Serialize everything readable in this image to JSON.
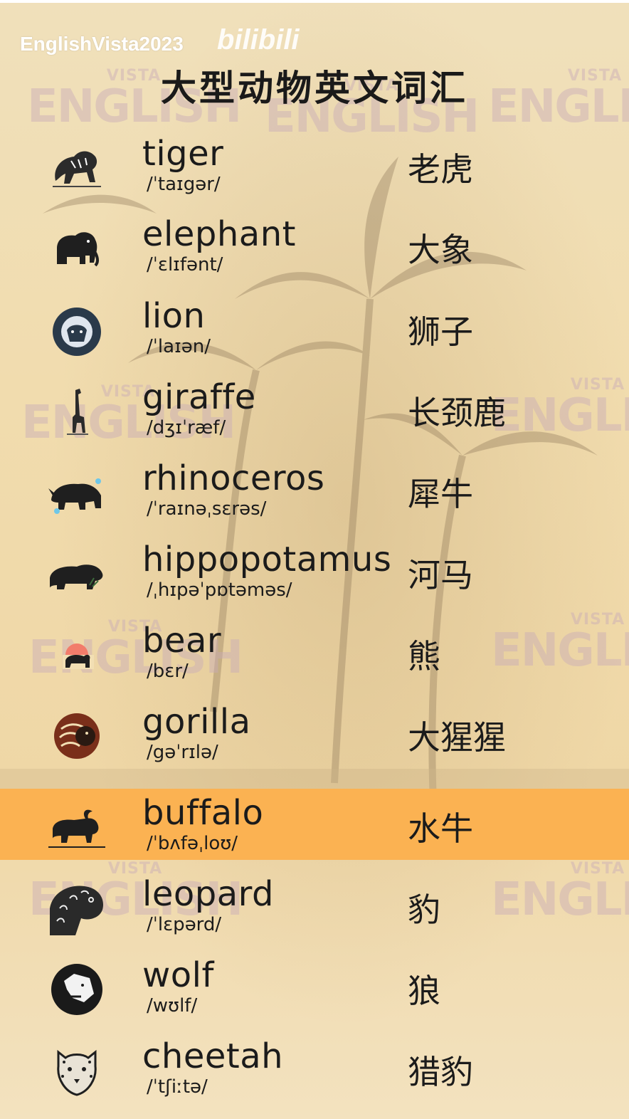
{
  "header": {
    "channel": "EnglishVista2023",
    "site_logo": "bilibili",
    "title": "大型动物英文词汇"
  },
  "watermark_text": "ENGLISH",
  "watermark_sub": "VISTA",
  "colors": {
    "background": "#f2dfb4",
    "highlight_row": "#fbb252",
    "text": "#1b1b1b"
  },
  "highlighted_index": 8,
  "words": [
    {
      "en": "tiger",
      "ipa": "/ˈtaɪgər/",
      "cn": "老虎",
      "icon": "tiger-icon"
    },
    {
      "en": "elephant",
      "ipa": "/ˈɛlɪfənt/",
      "cn": "大象",
      "icon": "elephant-icon"
    },
    {
      "en": "lion",
      "ipa": "/ˈlaɪən/",
      "cn": "狮子",
      "icon": "lion-icon"
    },
    {
      "en": "giraffe",
      "ipa": "/dʒɪˈræf/",
      "cn": "长颈鹿",
      "icon": "giraffe-icon"
    },
    {
      "en": "rhinoceros",
      "ipa": "/ˈraɪnəˌsɛrəs/",
      "cn": "犀牛",
      "icon": "rhinoceros-icon"
    },
    {
      "en": "hippopotamus",
      "ipa": "/ˌhɪpəˈpɒtəməs/",
      "cn": "河马",
      "icon": "hippopotamus-icon"
    },
    {
      "en": "bear",
      "ipa": "/bɛr/",
      "cn": "熊",
      "icon": "bear-icon"
    },
    {
      "en": "gorilla",
      "ipa": "/gəˈrɪlə/",
      "cn": "大猩猩",
      "icon": "gorilla-icon"
    },
    {
      "en": "buffalo",
      "ipa": "/ˈbʌfəˌloʊ/",
      "cn": "水牛",
      "icon": "buffalo-icon"
    },
    {
      "en": "leopard",
      "ipa": "/ˈlɛpərd/",
      "cn": "豹",
      "icon": "leopard-icon"
    },
    {
      "en": "wolf",
      "ipa": "/wʊlf/",
      "cn": "狼",
      "icon": "wolf-icon"
    },
    {
      "en": "cheetah",
      "ipa": "/ˈtʃiːtə/",
      "cn": "猎豹",
      "icon": "cheetah-icon"
    }
  ]
}
